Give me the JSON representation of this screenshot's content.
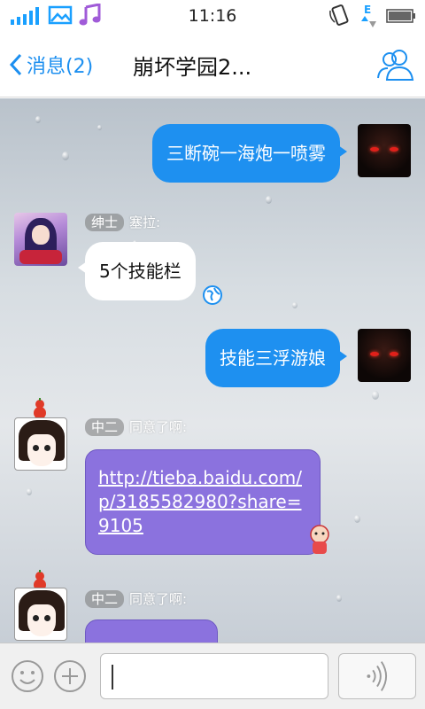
{
  "status_bar": {
    "time": "11:16",
    "network_type": "E",
    "icons": [
      "signal-icon",
      "gallery-icon",
      "music-icon",
      "screen-rotate-icon",
      "network-activity-icon",
      "battery-icon"
    ]
  },
  "header": {
    "back_label": "消息(2)",
    "title": "崩坏学园2...",
    "icons": [
      "chevron-left-icon",
      "group-members-icon"
    ]
  },
  "messages": [
    {
      "direction": "outgoing",
      "text": "三断碗一海炮一喷雾"
    },
    {
      "direction": "incoming",
      "tag": "绅士",
      "sender": "塞拉:",
      "text": "5个技能栏"
    },
    {
      "direction": "outgoing",
      "text": "技能三浮游娘"
    },
    {
      "direction": "incoming",
      "tag": "中二",
      "sender": "同意了啊:",
      "link": "http://tieba.baidu.com/p/3185582980?share=9105"
    },
    {
      "direction": "incoming",
      "tag": "中二",
      "sender": "同意了啊:"
    }
  ],
  "input_bar": {
    "placeholder": "",
    "icons": [
      "emoji-icon",
      "plus-icon",
      "voice-icon"
    ]
  },
  "colors": {
    "accent": "#1e90f0",
    "outgoing_bubble": "#1e90f0",
    "incoming_bubble": "#ffffff",
    "link_bubble": "#8b72de",
    "tag_bg": "#808080"
  }
}
